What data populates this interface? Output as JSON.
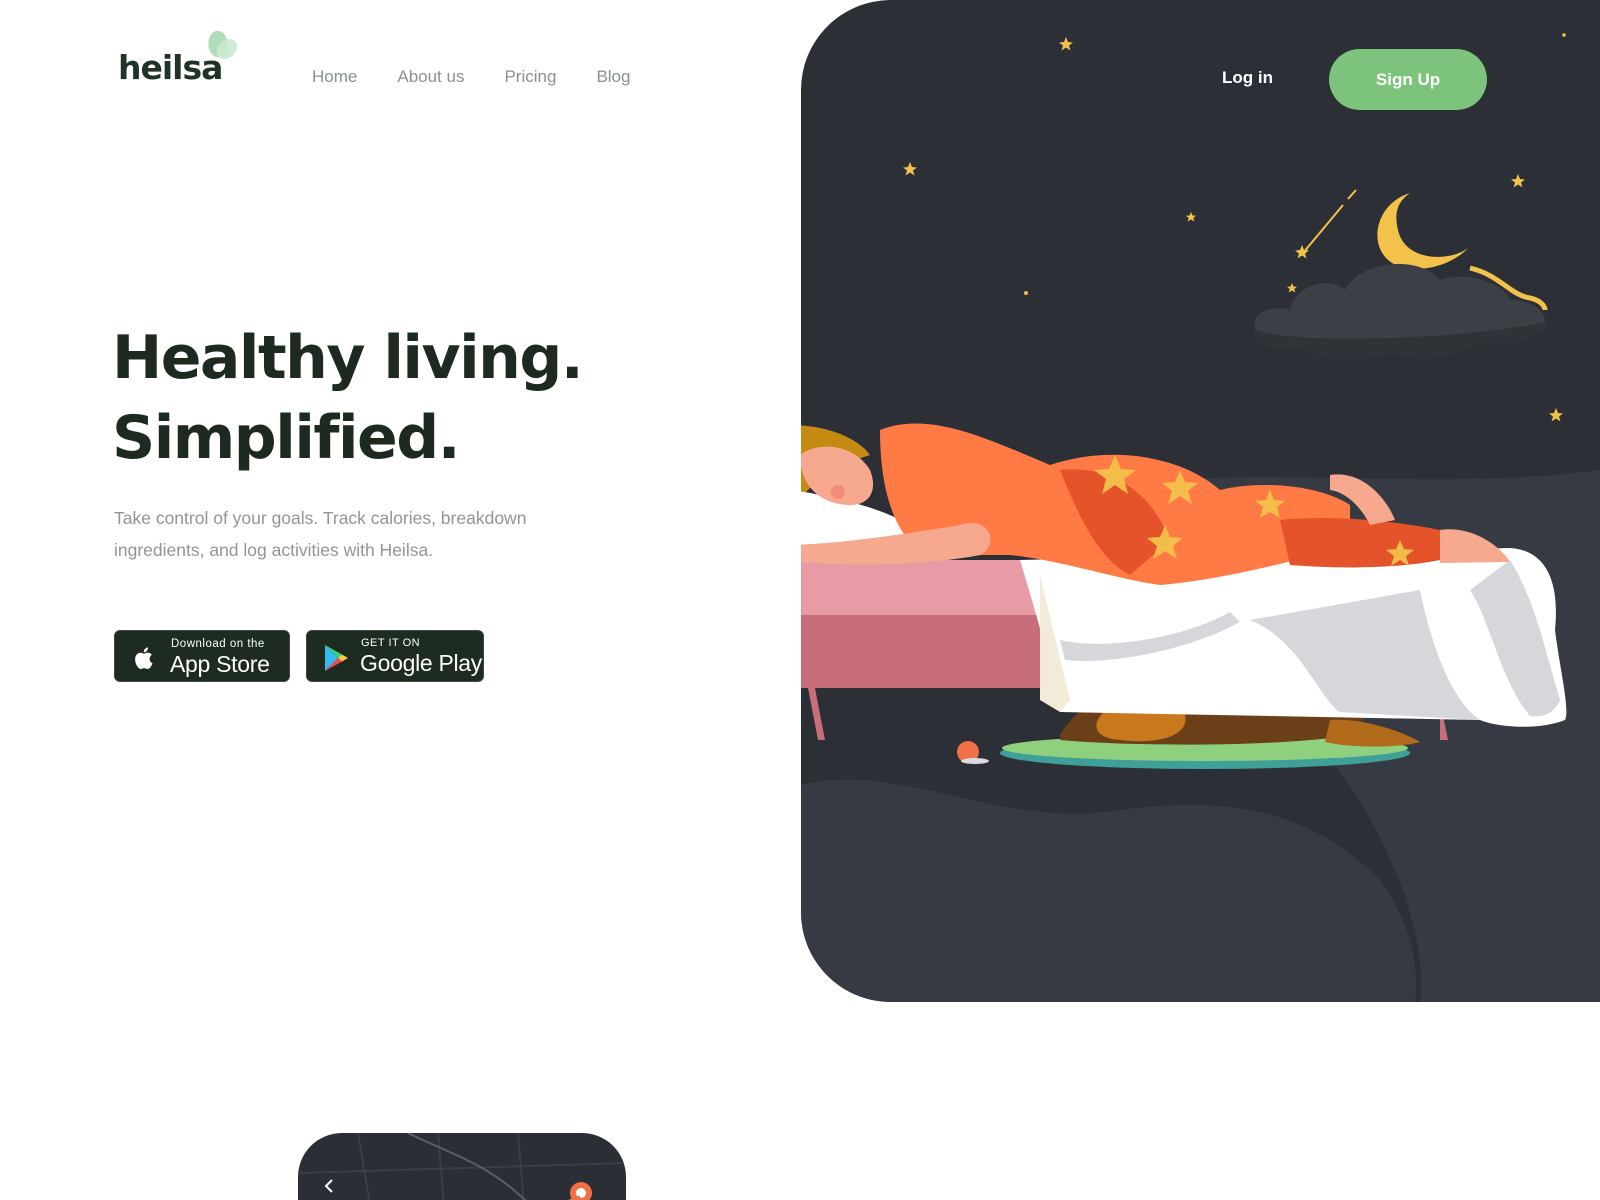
{
  "brand": {
    "name": "heilsa",
    "accent": "#7cc47b"
  },
  "nav": {
    "items": [
      {
        "label": "Home"
      },
      {
        "label": "About us"
      },
      {
        "label": "Pricing"
      },
      {
        "label": "Blog"
      }
    ],
    "login_label": "Log in",
    "signup_label": "Sign Up"
  },
  "hero": {
    "headline_line1": "Healthy living.",
    "headline_line2": "Simplified.",
    "subtitle": "Take control of your goals. Track calories, breakdown ingredients, and log activities with Heilsa."
  },
  "stores": {
    "apple": {
      "small": "Download on the",
      "big": "App Store",
      "icon": "apple-icon"
    },
    "google": {
      "small": "GET IT ON",
      "big": "Google Play",
      "icon": "google-play-icon"
    }
  },
  "colors": {
    "panel": "#2c2f36",
    "heading": "#1d2a20",
    "button_dark": "#1e2b21"
  },
  "phone_preview": {
    "back_icon": "chevron-left-icon"
  }
}
